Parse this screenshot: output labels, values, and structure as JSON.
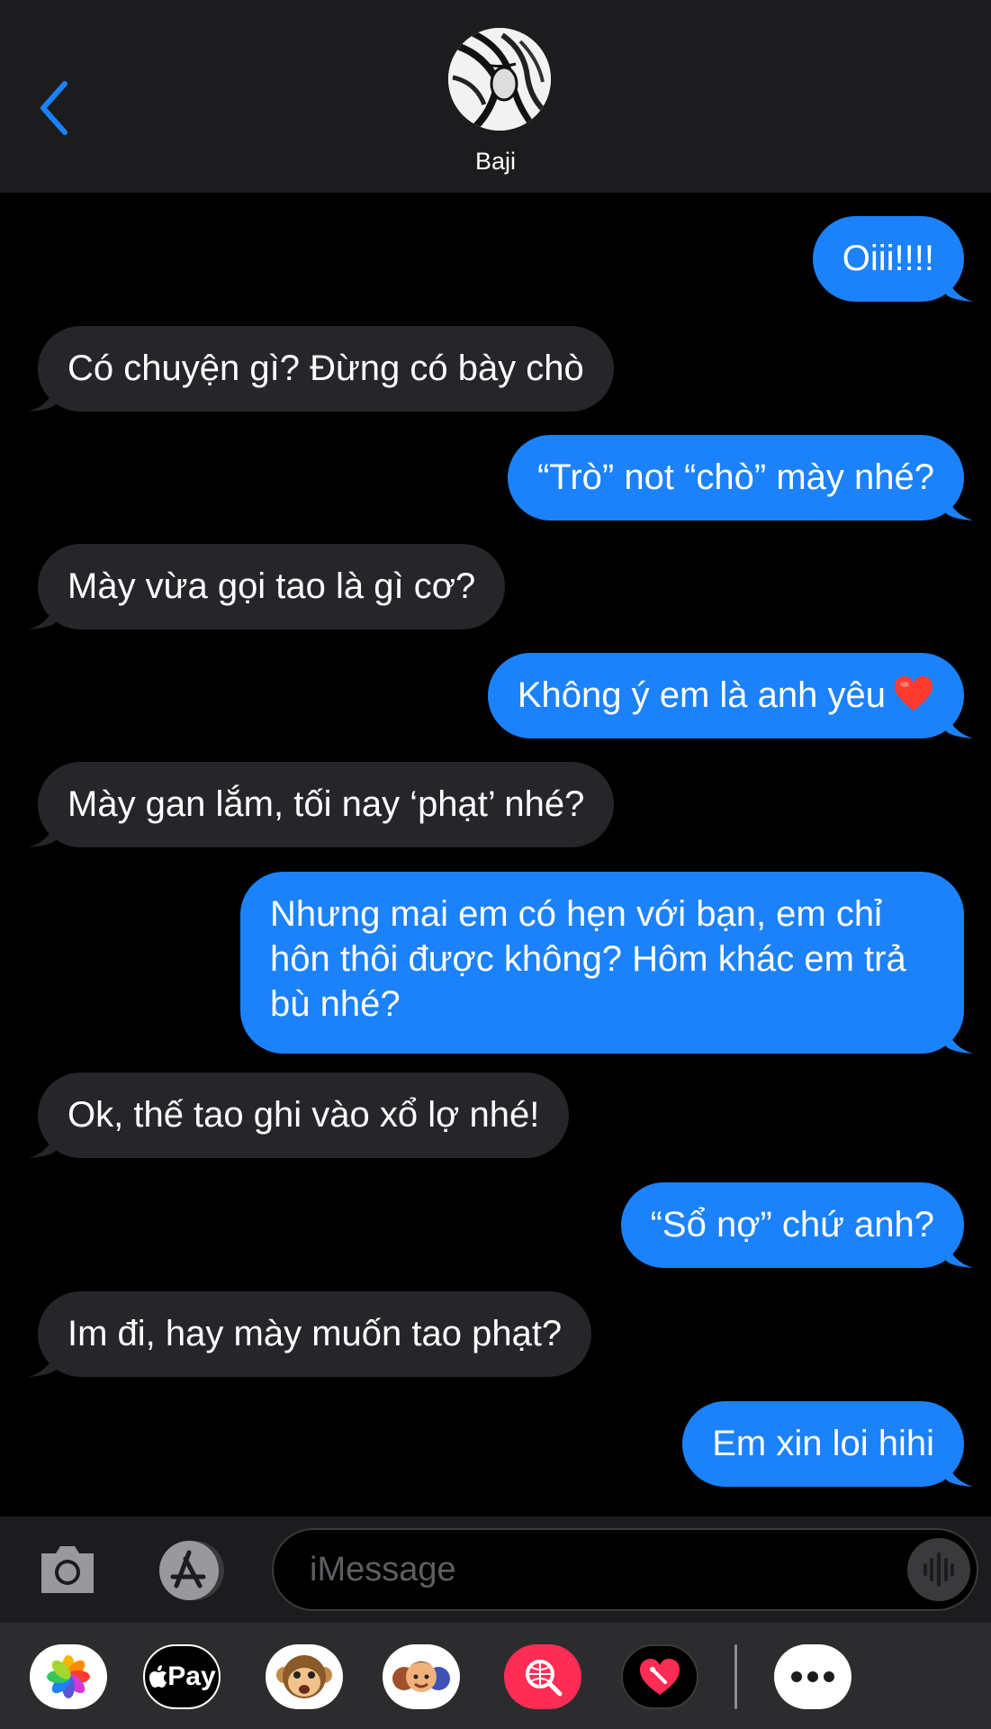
{
  "header": {
    "contact_name": "Baji"
  },
  "messages": [
    {
      "from": "me",
      "text": "Oiii!!!!"
    },
    {
      "from": "them",
      "text": "Có chuyện gì? Đừng có bày chò"
    },
    {
      "from": "me",
      "text": "“Trò” not “chò” mày nhé?"
    },
    {
      "from": "them",
      "text": "Mày vừa gọi tao là gì cơ?"
    },
    {
      "from": "me",
      "text": "Không ý em là anh yêu",
      "emoji": "heart"
    },
    {
      "from": "them",
      "text": "Mày gan lắm, tối nay ‘phạt’ nhé?"
    },
    {
      "from": "me",
      "text": "Nhưng mai em có hẹn với bạn, em chỉ hôn thôi được không? Hôm khác em trả bù nhé?"
    },
    {
      "from": "them",
      "text": "Ok, thế tao ghi vào xổ lợ nhé!"
    },
    {
      "from": "me",
      "text": "“Sổ nợ” chứ anh?"
    },
    {
      "from": "them",
      "text": "Im đi, hay mày muốn tao phạt?"
    },
    {
      "from": "me",
      "text": "Em xin loi hihi"
    }
  ],
  "composer": {
    "placeholder": "iMessage"
  },
  "drawer": {
    "apps": [
      "photos-icon",
      "apple-pay-icon",
      "animoji-icon",
      "memoji-icon",
      "image-search-icon",
      "digital-touch-icon",
      "more-icon"
    ],
    "pay_label": "Pay"
  },
  "colors": {
    "sent_bubble": "#1b82fb",
    "received_bubble": "#26252a",
    "header_bg": "#1c1c1e",
    "accent": "#1a82fb"
  }
}
